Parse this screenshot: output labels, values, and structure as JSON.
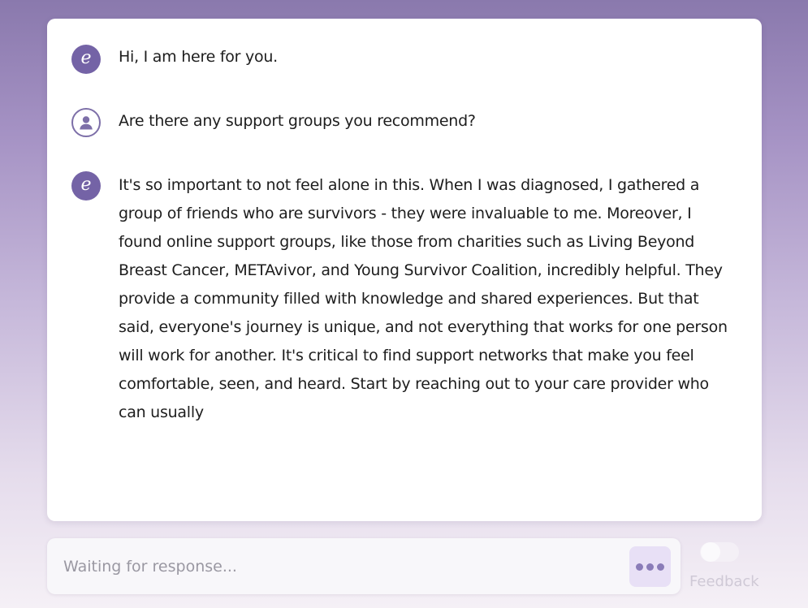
{
  "messages": [
    {
      "role": "bot",
      "avatar_icon": "elomia-logo-icon",
      "avatar_glyph": "e",
      "text": "Hi, I am here for you."
    },
    {
      "role": "user",
      "avatar_icon": "user-icon",
      "text": "Are there any support groups you recommend?"
    },
    {
      "role": "bot",
      "avatar_icon": "elomia-logo-icon",
      "avatar_glyph": "e",
      "text": "It's so important to not feel alone in this. When I was diagnosed, I gathered a group of friends who are survivors - they were invaluable to me. Moreover, I found online support groups, like those from charities such as Living Beyond Breast Cancer, METAvivor, and Young Survivor Coalition, incredibly helpful. They provide a community filled with knowledge and shared experiences. But that said, everyone's journey is unique, and not everything that works for one person will work for another. It's critical to find support networks that make you feel comfortable, seen, and heard. Start by reaching out to your care provider who can usually"
    }
  ],
  "input": {
    "placeholder": "Waiting for response...",
    "value": "",
    "send_icon": "typing-dots-icon"
  },
  "feedback": {
    "label": "Feedback",
    "toggle_on": false
  },
  "colors": {
    "accent": "#7463a6",
    "send_button_bg": "#e8e0f6",
    "background_top": "#8a79ad",
    "background_bottom": "#f5f0f6"
  }
}
